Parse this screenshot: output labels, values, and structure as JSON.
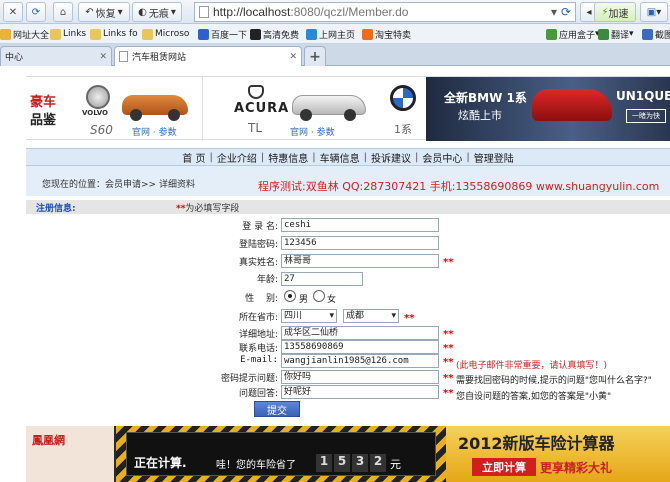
{
  "browser": {
    "back_label": "恢复",
    "noframe_label": "无痕",
    "url_host": "http://localhost",
    "url_rest": ":8080/qczl/Member.do",
    "speed_label": "加速",
    "bookmarks": [
      "网址大全",
      "Links",
      "Links fo",
      "Microso",
      "百度一下",
      "高清免费",
      "上网主页",
      "淘宝特卖",
      "应用盒子",
      "翻译",
      "截图"
    ],
    "tabs": [
      "中心",
      "汽车租赁网站"
    ]
  },
  "banner": {
    "haoche": "豪车",
    "pinjian": "品鉴",
    "models": [
      {
        "brand": "VOLVO",
        "model": "S60",
        "links": "官网 · 参数"
      },
      {
        "brand": "ACURA",
        "model": "TL",
        "links": "官网 · 参数"
      },
      {
        "brand": "BMW",
        "model": "1系",
        "links": ""
      }
    ],
    "promo_line1": "全新BMW 1系",
    "promo_line2": "炫酷上市",
    "promo_right": "UN1QUE.",
    "promo_btn": "一睹为快"
  },
  "nav": [
    "首 页",
    "企业介绍",
    "特惠信息",
    "车辆信息",
    "投诉建议",
    "会员中心",
    "管理登陆"
  ],
  "crumb": {
    "location": "您现在的位置：会员申请>> 详细资料",
    "author": "程序测试:双鱼林 QQ:287307421 手机:13558690869 www.shuangyulin.com"
  },
  "reg": {
    "title": "注册信息:",
    "required_mark": "**",
    "required_note": "为必填写字段"
  },
  "form": {
    "username_label": "登 录 名:",
    "username": "ceshi",
    "password_label": "登陆密码:",
    "password": "123456",
    "realname_label": "真实姓名:",
    "realname": "林哥哥",
    "age_label": "年龄:",
    "age": "27",
    "gender_label": "性　 别:",
    "male": "男",
    "female": "女",
    "province_label": "所在省市:",
    "province": "四川",
    "city": "成都",
    "address_label": "详细地址:",
    "address": "成华区二仙桥",
    "phone_label": "联系电话:",
    "phone": "13558690869",
    "email_label": "E-mail:",
    "email": "wangjianlin1985@126.com",
    "email_hint": "(此电子邮件非常重要，请认真填写！)",
    "question_label": "密码提示问题:",
    "question": "你好吗",
    "question_hint": "需要找回密码的时候,提示的问题\"您叫什么名字?\"",
    "answer_label": "问题回答:",
    "answer": "好呢好",
    "answer_hint": "您自设问题的答案,如您的答案是\"小黄\"",
    "submit": "提交"
  },
  "ad": {
    "logo": "鳳凰網",
    "calc": "正在计算.",
    "saved": "哇！您的车险省了",
    "digits": [
      "1",
      "5",
      "3",
      "2"
    ],
    "unit": "元",
    "title": "2012新版车险计算器",
    "cta": "立即计算",
    "more": "更享精彩大礼"
  },
  "colors": {
    "accent": "#d41e1e",
    "nav_bg": "#dce9f6",
    "star": "#e00000"
  }
}
